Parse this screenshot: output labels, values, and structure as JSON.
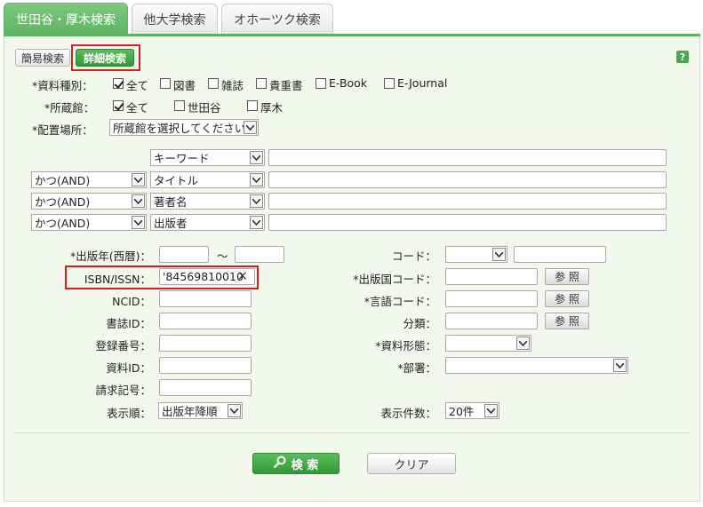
{
  "tabs": [
    {
      "label": "世田谷・厚木検索",
      "active": true
    },
    {
      "label": "他大学検索",
      "active": false
    },
    {
      "label": "オホーツク検索",
      "active": false
    }
  ],
  "mode": {
    "simple": "簡易検索",
    "advanced": "詳細検索",
    "help": "?"
  },
  "material_type": {
    "label": "*資料種別：",
    "options": [
      {
        "label": "全て",
        "checked": true
      },
      {
        "label": "図書",
        "checked": false
      },
      {
        "label": "雑誌",
        "checked": false
      },
      {
        "label": "貴重書",
        "checked": false
      },
      {
        "label": "E-Book",
        "checked": false
      },
      {
        "label": "E-Journal",
        "checked": false
      }
    ]
  },
  "holding_library": {
    "label": "*所蔵館：",
    "options": [
      {
        "label": "全て",
        "checked": true
      },
      {
        "label": "世田谷",
        "checked": false
      },
      {
        "label": "厚木",
        "checked": false
      }
    ]
  },
  "location": {
    "label": "*配置場所：",
    "value": "所蔵館を選択してください"
  },
  "keyword_rows": [
    {
      "op": "",
      "field": "キーワード",
      "value": ""
    },
    {
      "op": "かつ(AND)",
      "field": "タイトル",
      "value": ""
    },
    {
      "op": "かつ(AND)",
      "field": "著者名",
      "value": ""
    },
    {
      "op": "かつ(AND)",
      "field": "出版者",
      "value": ""
    }
  ],
  "left_fields": {
    "pub_year": {
      "label": "*出版年(西暦)：",
      "from": "",
      "tilde": "～",
      "to": ""
    },
    "isbn": {
      "label": "ISBN/ISSN：",
      "value": "'84569810010",
      "clear": "×"
    },
    "ncid": {
      "label": "NCID：",
      "value": ""
    },
    "bib_id": {
      "label": "書誌ID：",
      "value": ""
    },
    "reg_no": {
      "label": "登録番号：",
      "value": ""
    },
    "item_id": {
      "label": "資料ID：",
      "value": ""
    },
    "call_no": {
      "label": "請求記号：",
      "value": ""
    },
    "sort": {
      "label": "表示順：",
      "value": "出版年降順"
    }
  },
  "right_fields": {
    "code": {
      "label": "コード：",
      "type": "",
      "value": ""
    },
    "country": {
      "label": "*出版国コード：",
      "value": "",
      "ref": "参 照"
    },
    "language": {
      "label": "*言語コード：",
      "value": "",
      "ref": "参 照"
    },
    "classification": {
      "label": "分類：",
      "value": "",
      "ref": "参 照"
    },
    "format": {
      "label": "*資料形態：",
      "value": ""
    },
    "department": {
      "label": "*部署：",
      "value": ""
    },
    "count": {
      "label": "表示件数：",
      "value": "20件"
    }
  },
  "actions": {
    "search": "検 索",
    "clear": "クリア"
  },
  "colors": {
    "accent": "#5eb561",
    "panel": "#f2f8ec",
    "highlight": "#d21f1f"
  }
}
